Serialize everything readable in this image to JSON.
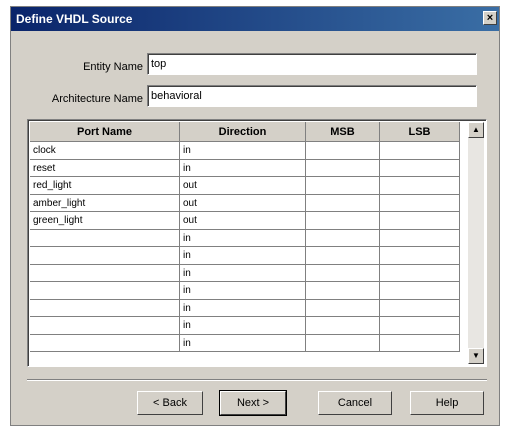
{
  "window": {
    "title": "Define VHDL Source",
    "close_symbol": "×"
  },
  "form": {
    "entity_label": "Entity Name",
    "entity_value": "top",
    "arch_label": "Architecture Name",
    "arch_value": "behavioral"
  },
  "table": {
    "columns": [
      "Port Name",
      "Direction",
      "MSB",
      "LSB"
    ],
    "rows": [
      [
        "clock",
        "in",
        "",
        ""
      ],
      [
        "reset",
        "in",
        "",
        ""
      ],
      [
        "red_light",
        "out",
        "",
        ""
      ],
      [
        "amber_light",
        "out",
        "",
        ""
      ],
      [
        "green_light",
        "out",
        "",
        ""
      ],
      [
        "",
        "in",
        "",
        ""
      ],
      [
        "",
        "in",
        "",
        ""
      ],
      [
        "",
        "in",
        "",
        ""
      ],
      [
        "",
        "in",
        "",
        ""
      ],
      [
        "",
        "in",
        "",
        ""
      ],
      [
        "",
        "in",
        "",
        ""
      ],
      [
        "",
        "in",
        "",
        ""
      ]
    ]
  },
  "buttons": {
    "back": "< Back",
    "next": "Next >",
    "cancel": "Cancel",
    "help": "Help"
  },
  "icons": {
    "scroll_up": "scroll-up-arrow-icon",
    "scroll_down": "scroll-down-arrow-icon"
  }
}
